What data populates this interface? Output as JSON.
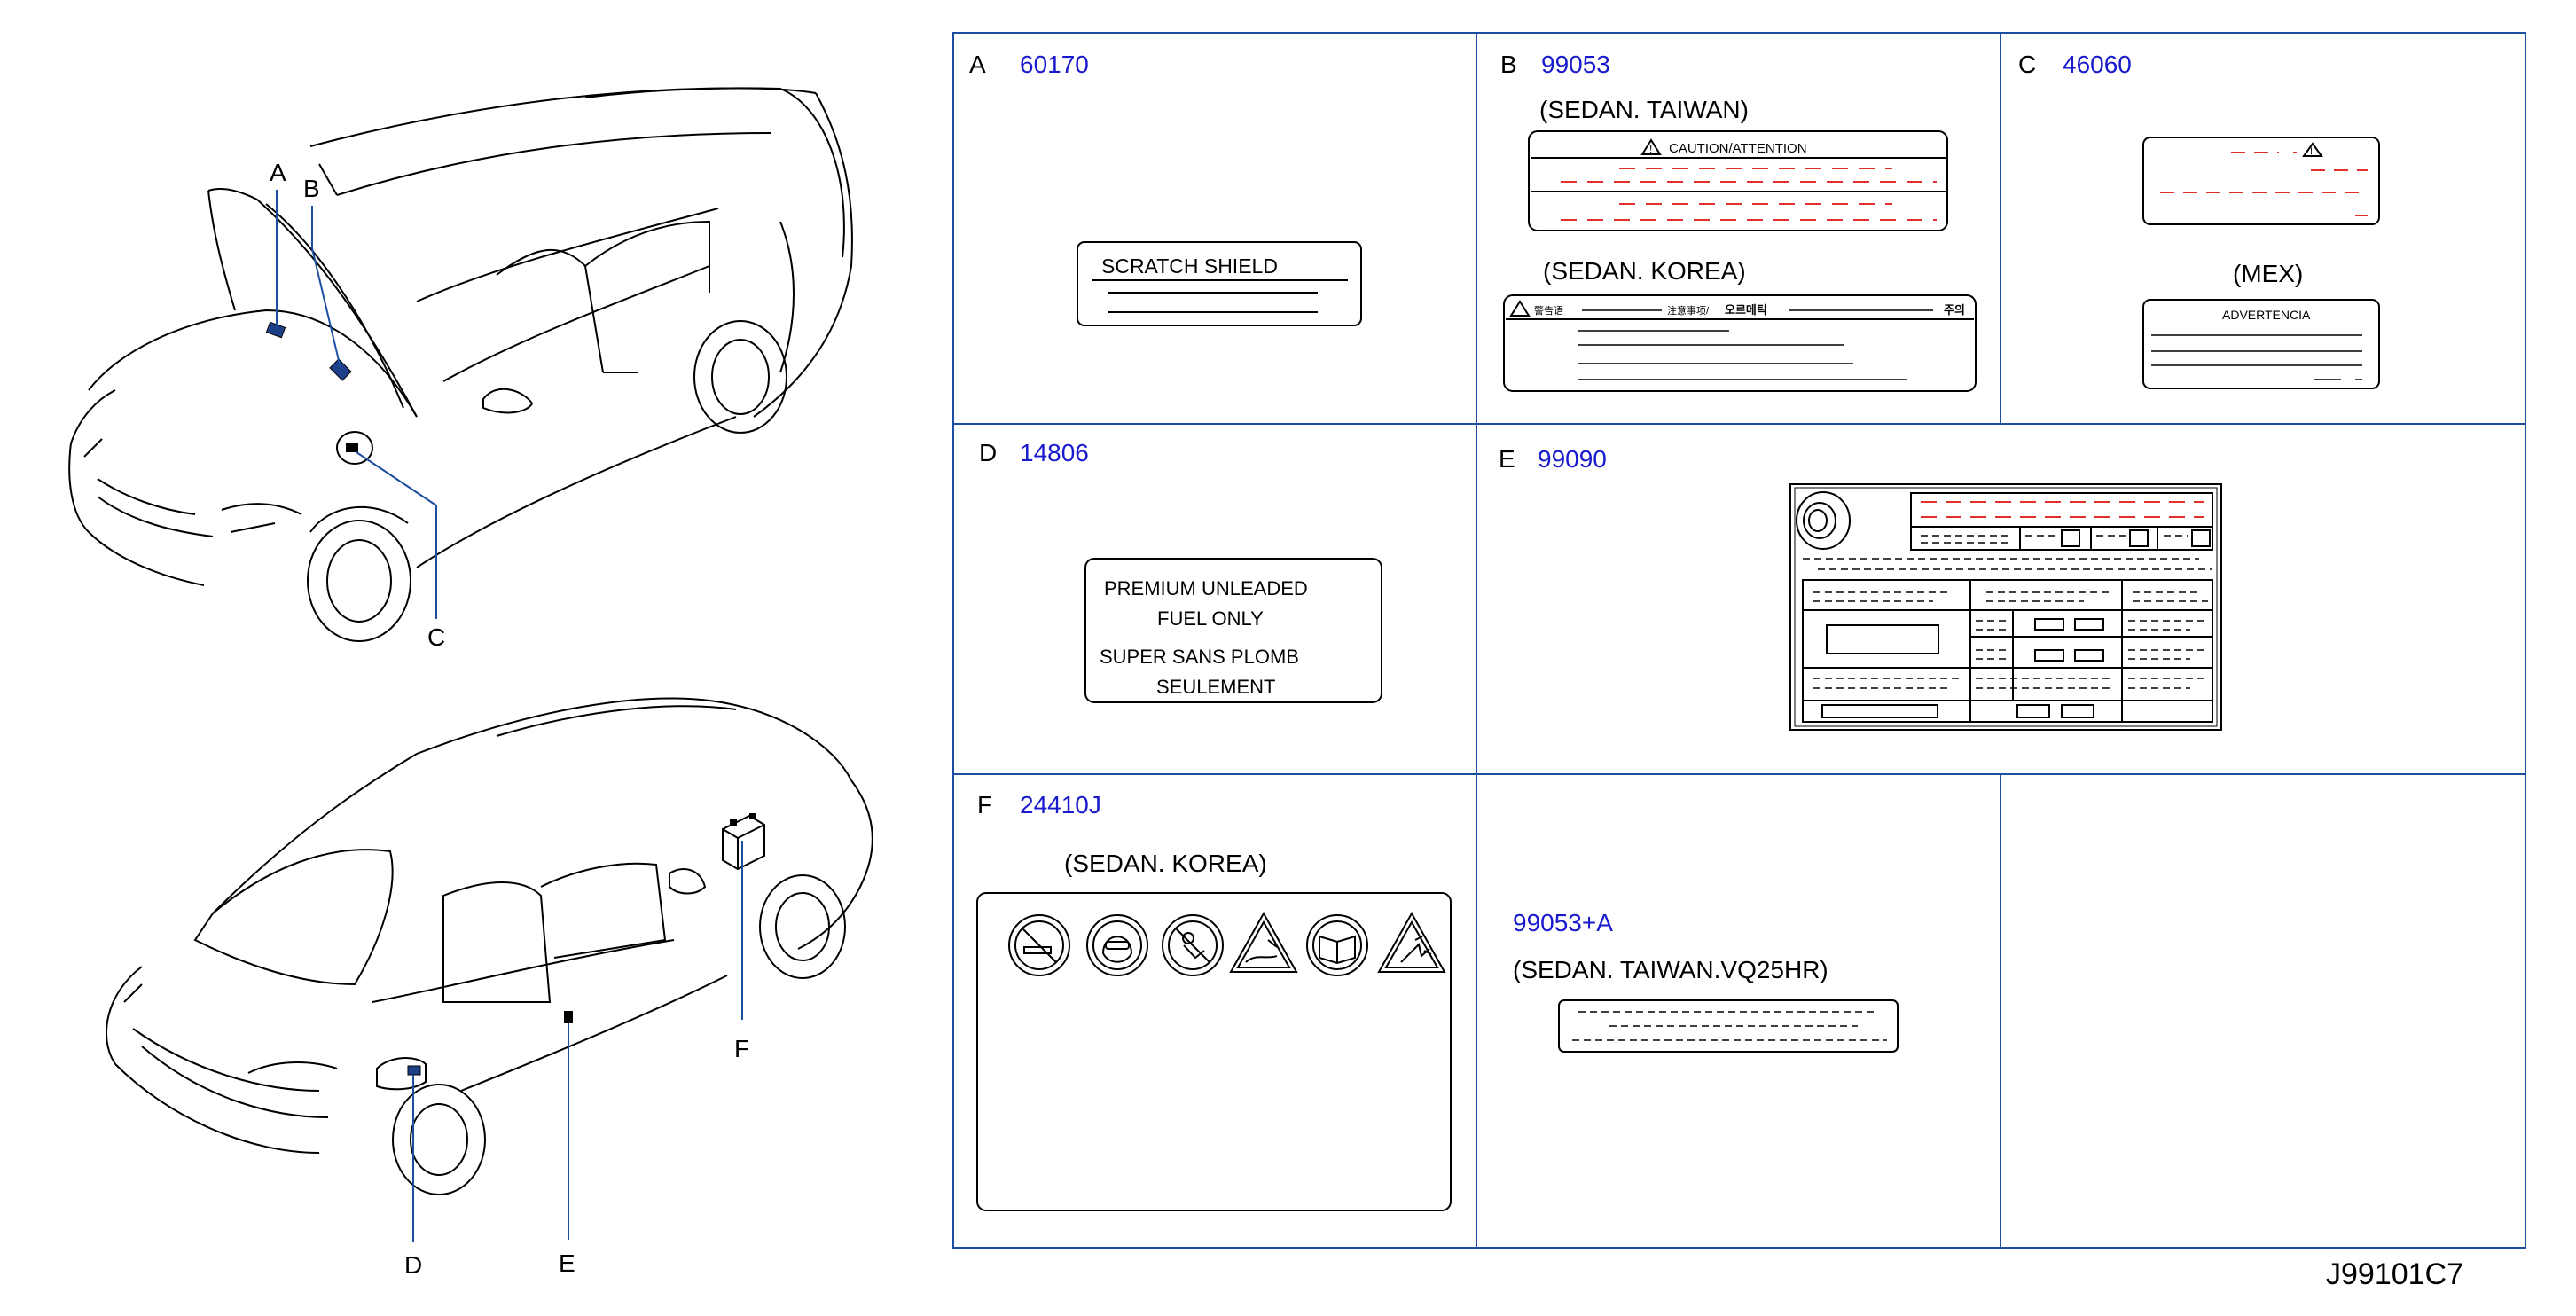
{
  "callouts": {
    "A": "A",
    "B": "B",
    "C": "C",
    "D": "D",
    "E": "E",
    "F": "F"
  },
  "cells": {
    "A": {
      "letter": "A",
      "part": "60170",
      "label_line": "SCRATCH   SHIELD"
    },
    "B": {
      "letter": "B",
      "part": "99053",
      "variant_taiwan": "(SEDAN.   TAIWAN)",
      "caution": "CAUTION/ATTENTION",
      "variant_korea": "(SEDAN.   KOREA)",
      "korea_cn": "警告语",
      "korea_mid": "注意事项/",
      "korea_kr1": "오르메틱",
      "korea_kr2": "주의"
    },
    "C": {
      "letter": "C",
      "part": "46060",
      "variant_mex": "(MEX)",
      "advert": "ADVERTENCIA"
    },
    "D": {
      "letter": "D",
      "part": "14806",
      "line1": "PREMIUM    UNLEADED",
      "line2": "FUEL    ONLY",
      "line3": "SUPER    SANS    PLOMB",
      "line4": "SEULEMENT"
    },
    "E": {
      "letter": "E",
      "part": "99090"
    },
    "F": {
      "letter": "F",
      "part": "24410J",
      "variant": "(SEDAN.   KOREA)"
    },
    "G": {
      "part": "99053+A",
      "variant": "(SEDAN.   TAIWAN.VQ25HR)"
    }
  },
  "diagram_code": "J99101C7",
  "colors": {
    "part_number": "#1a1acd",
    "leader": "#1d4fa0",
    "dash_red": "#e0302a",
    "line": "#000000"
  }
}
